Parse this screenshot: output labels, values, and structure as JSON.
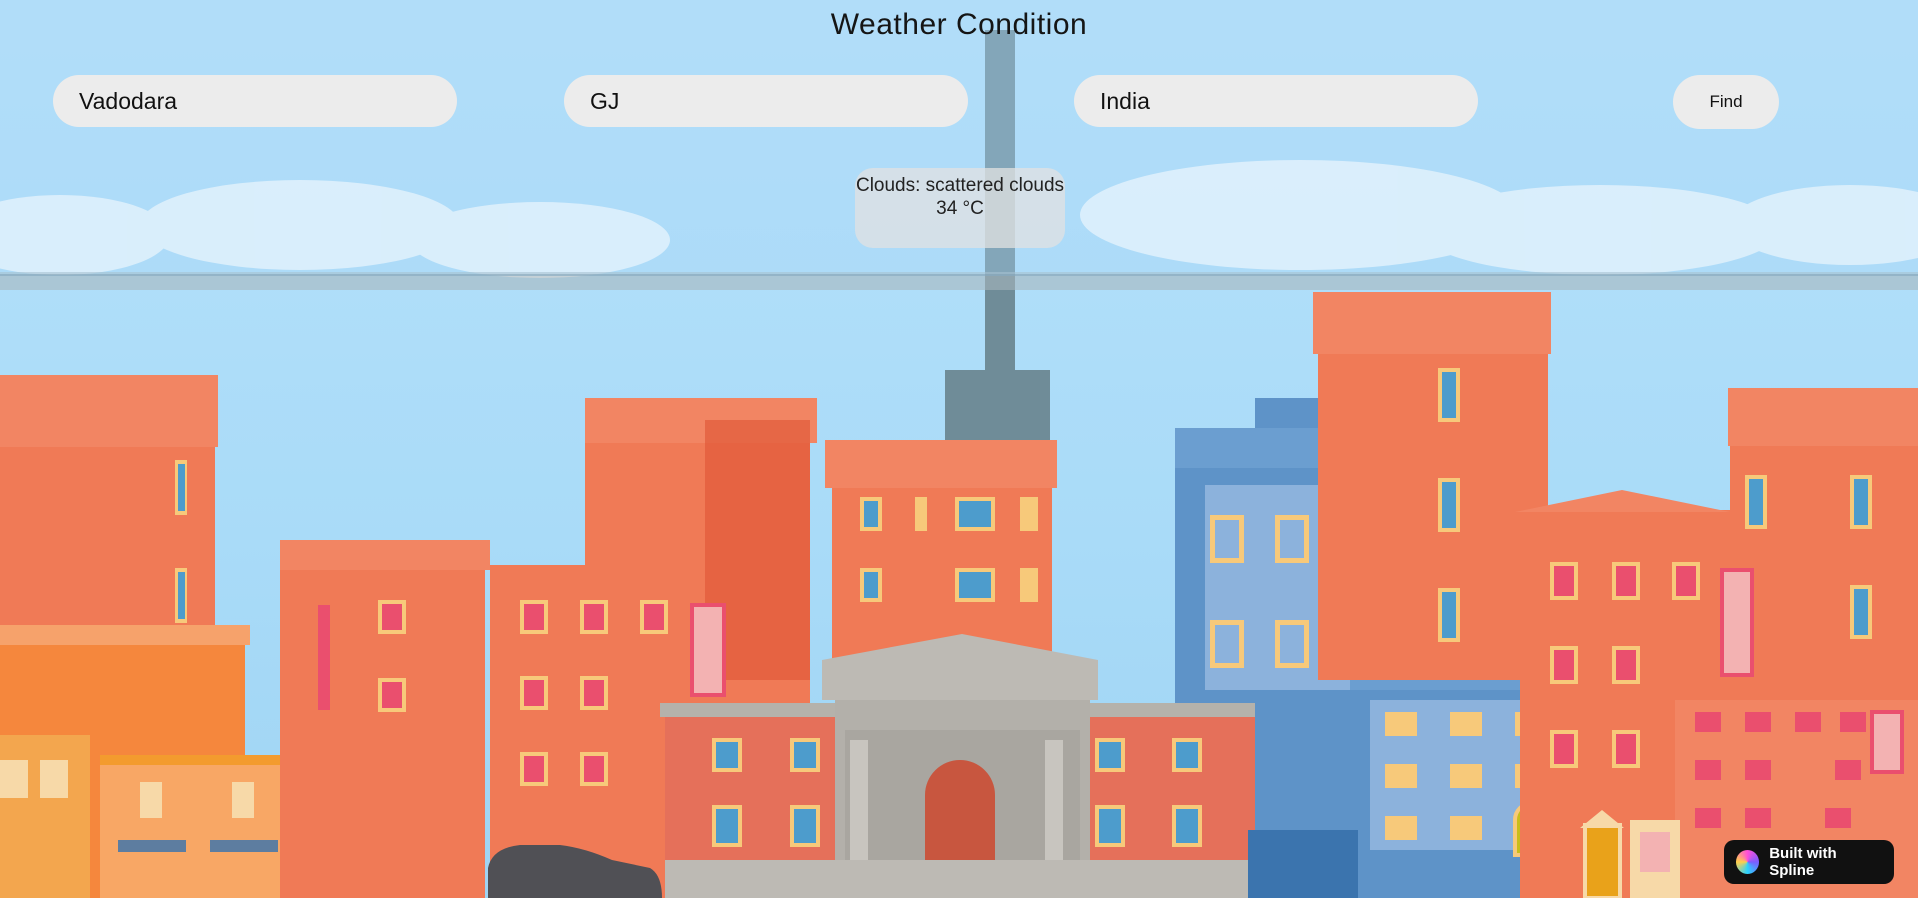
{
  "header": {
    "title": "Weather Condition"
  },
  "form": {
    "city": {
      "value": "Vadodara"
    },
    "state": {
      "value": "GJ"
    },
    "country": {
      "value": "India"
    },
    "find_label": "Find"
  },
  "result": {
    "condition": "Clouds: scattered clouds",
    "temperature": "34 °C"
  },
  "badge": {
    "label": "Built with Spline",
    "icon": "spline-logo-icon"
  },
  "colors": {
    "sky": "#b6e1fb",
    "field_bg": "#ececec",
    "building_orange": "#f07a56",
    "building_blue": "#5e93c8"
  }
}
